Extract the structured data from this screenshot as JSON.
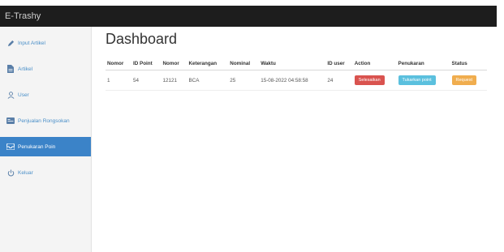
{
  "app": {
    "title": "E-Trashy"
  },
  "sidebar": {
    "items": [
      {
        "label": "Input Artikel",
        "icon": "pencil-icon"
      },
      {
        "label": "Artikel",
        "icon": "document-icon"
      },
      {
        "label": "User",
        "icon": "user-icon"
      },
      {
        "label": "Penjualan Rongsokan",
        "icon": "id-card-icon"
      },
      {
        "label": "Penukaran Poin",
        "icon": "inbox-icon",
        "active": true
      },
      {
        "label": "Keluar",
        "icon": "power-icon"
      }
    ]
  },
  "main": {
    "title": "Dashboard",
    "table": {
      "headers": [
        "Nomor",
        "ID Point",
        "Nomor",
        "Keterangan",
        "Nominal",
        "Waktu",
        "ID user",
        "Action",
        "Penukaran",
        "Status"
      ],
      "rows": [
        {
          "nomor": "1",
          "id_point": "54",
          "nomor2": "12121",
          "keterangan": "BCA",
          "nominal": "25",
          "waktu": "15-08-2022 04:58:58",
          "id_user": "24",
          "action": "Selesaikan",
          "penukaran": "Tukarkan point",
          "status": "Request"
        }
      ]
    }
  },
  "colors": {
    "topbar": "#1d1d1d",
    "active_nav": "#3b83c8",
    "action_button": "#d9534f",
    "penukaran_button": "#5bc0de",
    "status_button": "#f0ad4e"
  }
}
